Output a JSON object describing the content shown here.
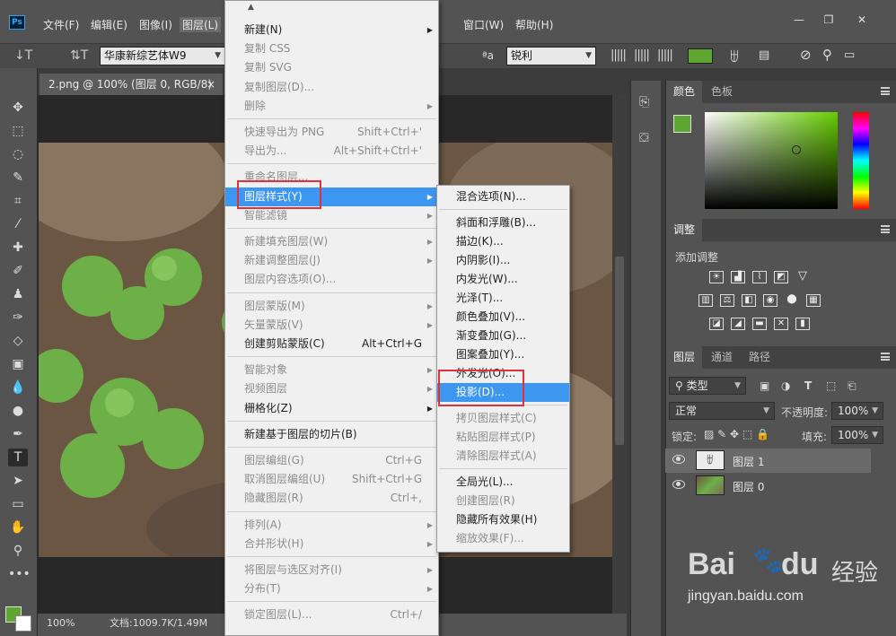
{
  "menubar": {
    "items": [
      "文件(F)",
      "编辑(E)",
      "图像(I)",
      "图层(L)",
      "窗口(W)",
      "帮助(H)"
    ],
    "window_controls": [
      "—",
      "❐",
      "✕"
    ]
  },
  "options": {
    "font_family": "华康新综艺体W9",
    "aa_label": "ªa",
    "antialias": "锐利",
    "accent_color": "#5ea832"
  },
  "document": {
    "tab_title": "2.png @ 100% (图层 0, RGB/8)",
    "close_symbol": "×",
    "zoom": "100%",
    "doc_info": "文档:1009.7K/1.49M"
  },
  "panels": {
    "color": {
      "tabs": [
        "颜色",
        "色板"
      ],
      "fg": "#5ea832"
    },
    "adjust": {
      "tab": "调整",
      "title": "添加调整"
    },
    "layers": {
      "tabs": [
        "图层",
        "通道",
        "路径"
      ],
      "kind": "类型",
      "blend": "正常",
      "opacity_label": "不透明度:",
      "opacity": "100%",
      "lock_label": "锁定:",
      "fill_label": "填充:",
      "fill": "100%",
      "items": [
        {
          "name": "图层 1",
          "type": "text"
        },
        {
          "name": "图层 0",
          "type": "image"
        }
      ]
    }
  },
  "layer_menu": {
    "items": [
      {
        "label": "新建(N)",
        "sub": true
      },
      {
        "label": "复制 CSS",
        "dis": true
      },
      {
        "label": "复制 SVG",
        "dis": true
      },
      {
        "label": "复制图层(D)...",
        "dis": true
      },
      {
        "label": "删除",
        "dis": true,
        "sub": true
      },
      {
        "sep": true
      },
      {
        "label": "快速导出为 PNG",
        "dis": true,
        "sc": "Shift+Ctrl+'"
      },
      {
        "label": "导出为...",
        "dis": true,
        "sc": "Alt+Shift+Ctrl+'"
      },
      {
        "sep": true
      },
      {
        "label": "重命名图层...",
        "dis": true
      },
      {
        "label": "图层样式(Y)",
        "hi": true,
        "sub": true
      },
      {
        "label": "智能滤镜",
        "dis": true,
        "sub": true
      },
      {
        "sep": true
      },
      {
        "label": "新建填充图层(W)",
        "dis": true,
        "sub": true
      },
      {
        "label": "新建调整图层(J)",
        "dis": true,
        "sub": true
      },
      {
        "label": "图层内容选项(O)...",
        "dis": true
      },
      {
        "sep": true
      },
      {
        "label": "图层蒙版(M)",
        "dis": true,
        "sub": true
      },
      {
        "label": "矢量蒙版(V)",
        "dis": true,
        "sub": true
      },
      {
        "label": "创建剪贴蒙版(C)",
        "sc": "Alt+Ctrl+G"
      },
      {
        "sep": true
      },
      {
        "label": "智能对象",
        "dis": true,
        "sub": true
      },
      {
        "label": "视频图层",
        "dis": true,
        "sub": true
      },
      {
        "label": "栅格化(Z)",
        "sub": true
      },
      {
        "sep": true
      },
      {
        "label": "新建基于图层的切片(B)"
      },
      {
        "sep": true
      },
      {
        "label": "图层编组(G)",
        "dis": true,
        "sc": "Ctrl+G"
      },
      {
        "label": "取消图层编组(U)",
        "dis": true,
        "sc": "Shift+Ctrl+G"
      },
      {
        "label": "隐藏图层(R)",
        "dis": true,
        "sc": "Ctrl+,"
      },
      {
        "sep": true
      },
      {
        "label": "排列(A)",
        "dis": true,
        "sub": true
      },
      {
        "label": "合并形状(H)",
        "dis": true,
        "sub": true
      },
      {
        "sep": true
      },
      {
        "label": "将图层与选区对齐(I)",
        "dis": true,
        "sub": true
      },
      {
        "label": "分布(T)",
        "dis": true,
        "sub": true
      },
      {
        "sep": true
      },
      {
        "label": "锁定图层(L)...",
        "dis": true,
        "sc": "Ctrl+/"
      }
    ]
  },
  "style_menu": {
    "items": [
      {
        "label": "混合选项(N)..."
      },
      {
        "sep": true
      },
      {
        "label": "斜面和浮雕(B)..."
      },
      {
        "label": "描边(K)..."
      },
      {
        "label": "内阴影(I)..."
      },
      {
        "label": "内发光(W)..."
      },
      {
        "label": "光泽(T)..."
      },
      {
        "label": "颜色叠加(V)..."
      },
      {
        "label": "渐变叠加(G)..."
      },
      {
        "label": "图案叠加(Y)..."
      },
      {
        "label": "外发光(O)..."
      },
      {
        "label": "投影(D)...",
        "hi": true
      },
      {
        "sep": true
      },
      {
        "label": "拷贝图层样式(C)",
        "dis": true
      },
      {
        "label": "粘贴图层样式(P)",
        "dis": true
      },
      {
        "label": "清除图层样式(A)",
        "dis": true
      },
      {
        "sep": true
      },
      {
        "label": "全局光(L)..."
      },
      {
        "label": "创建图层(R)",
        "dis": true
      },
      {
        "label": "隐藏所有效果(H)"
      },
      {
        "label": "缩放效果(F)...",
        "dis": true
      }
    ]
  },
  "watermark": {
    "brand": "Bai",
    "brand2": "du",
    "cn": "经验",
    "url": "jingyan.baidu.com"
  }
}
